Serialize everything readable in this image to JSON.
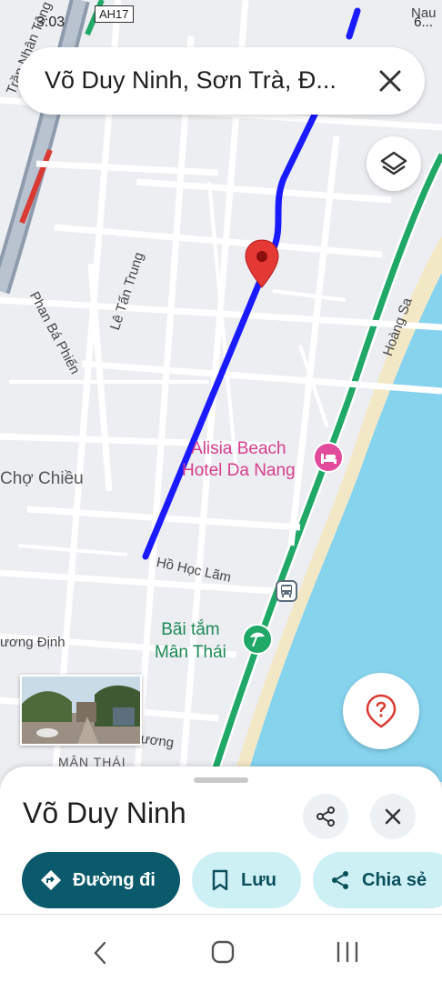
{
  "status_bar": {
    "time": "3:03",
    "tag": "AH17",
    "battery": "6..."
  },
  "search": {
    "query": "Võ Duy Ninh, Sơn Trà, Đ..."
  },
  "map": {
    "streets": {
      "tran_nhan_tong": "Trần Nhân Tông",
      "le_tan_trung": "Lê Tấn Trung",
      "phan_ba_phien": "Phan Bá Phiến",
      "ho_hoc_lam": "Hồ Học Lãm",
      "hoang_sa": "Hoàng Sa",
      "cho_chieu": "Chợ Chiều",
      "uong_dinh": "ương Định",
      "uong": "ương",
      "nau": "Nau"
    },
    "pois": {
      "hotel_line1": "Alisia Beach",
      "hotel_line2": "Hotel Da Nang",
      "beach_line1": "Bãi tắm",
      "beach_line2": "Mân Thái"
    },
    "district": "MÂN THÁI",
    "route_color": "#1a1aff",
    "water_color": "#86d3ee",
    "coast_road_color": "#1fa866"
  },
  "place_sheet": {
    "title": "Võ Duy Ninh",
    "actions": {
      "directions": "Đường đi",
      "save": "Lưu",
      "share": "Chia sẻ"
    }
  },
  "icons": [
    "layers-icon",
    "close-icon",
    "share-icon",
    "help-marker-icon",
    "directions-icon",
    "bookmark-icon",
    "bus-stop-icon",
    "beach-icon",
    "hotel-icon",
    "location-pin-icon",
    "back-icon",
    "home-icon",
    "recents-icon"
  ]
}
